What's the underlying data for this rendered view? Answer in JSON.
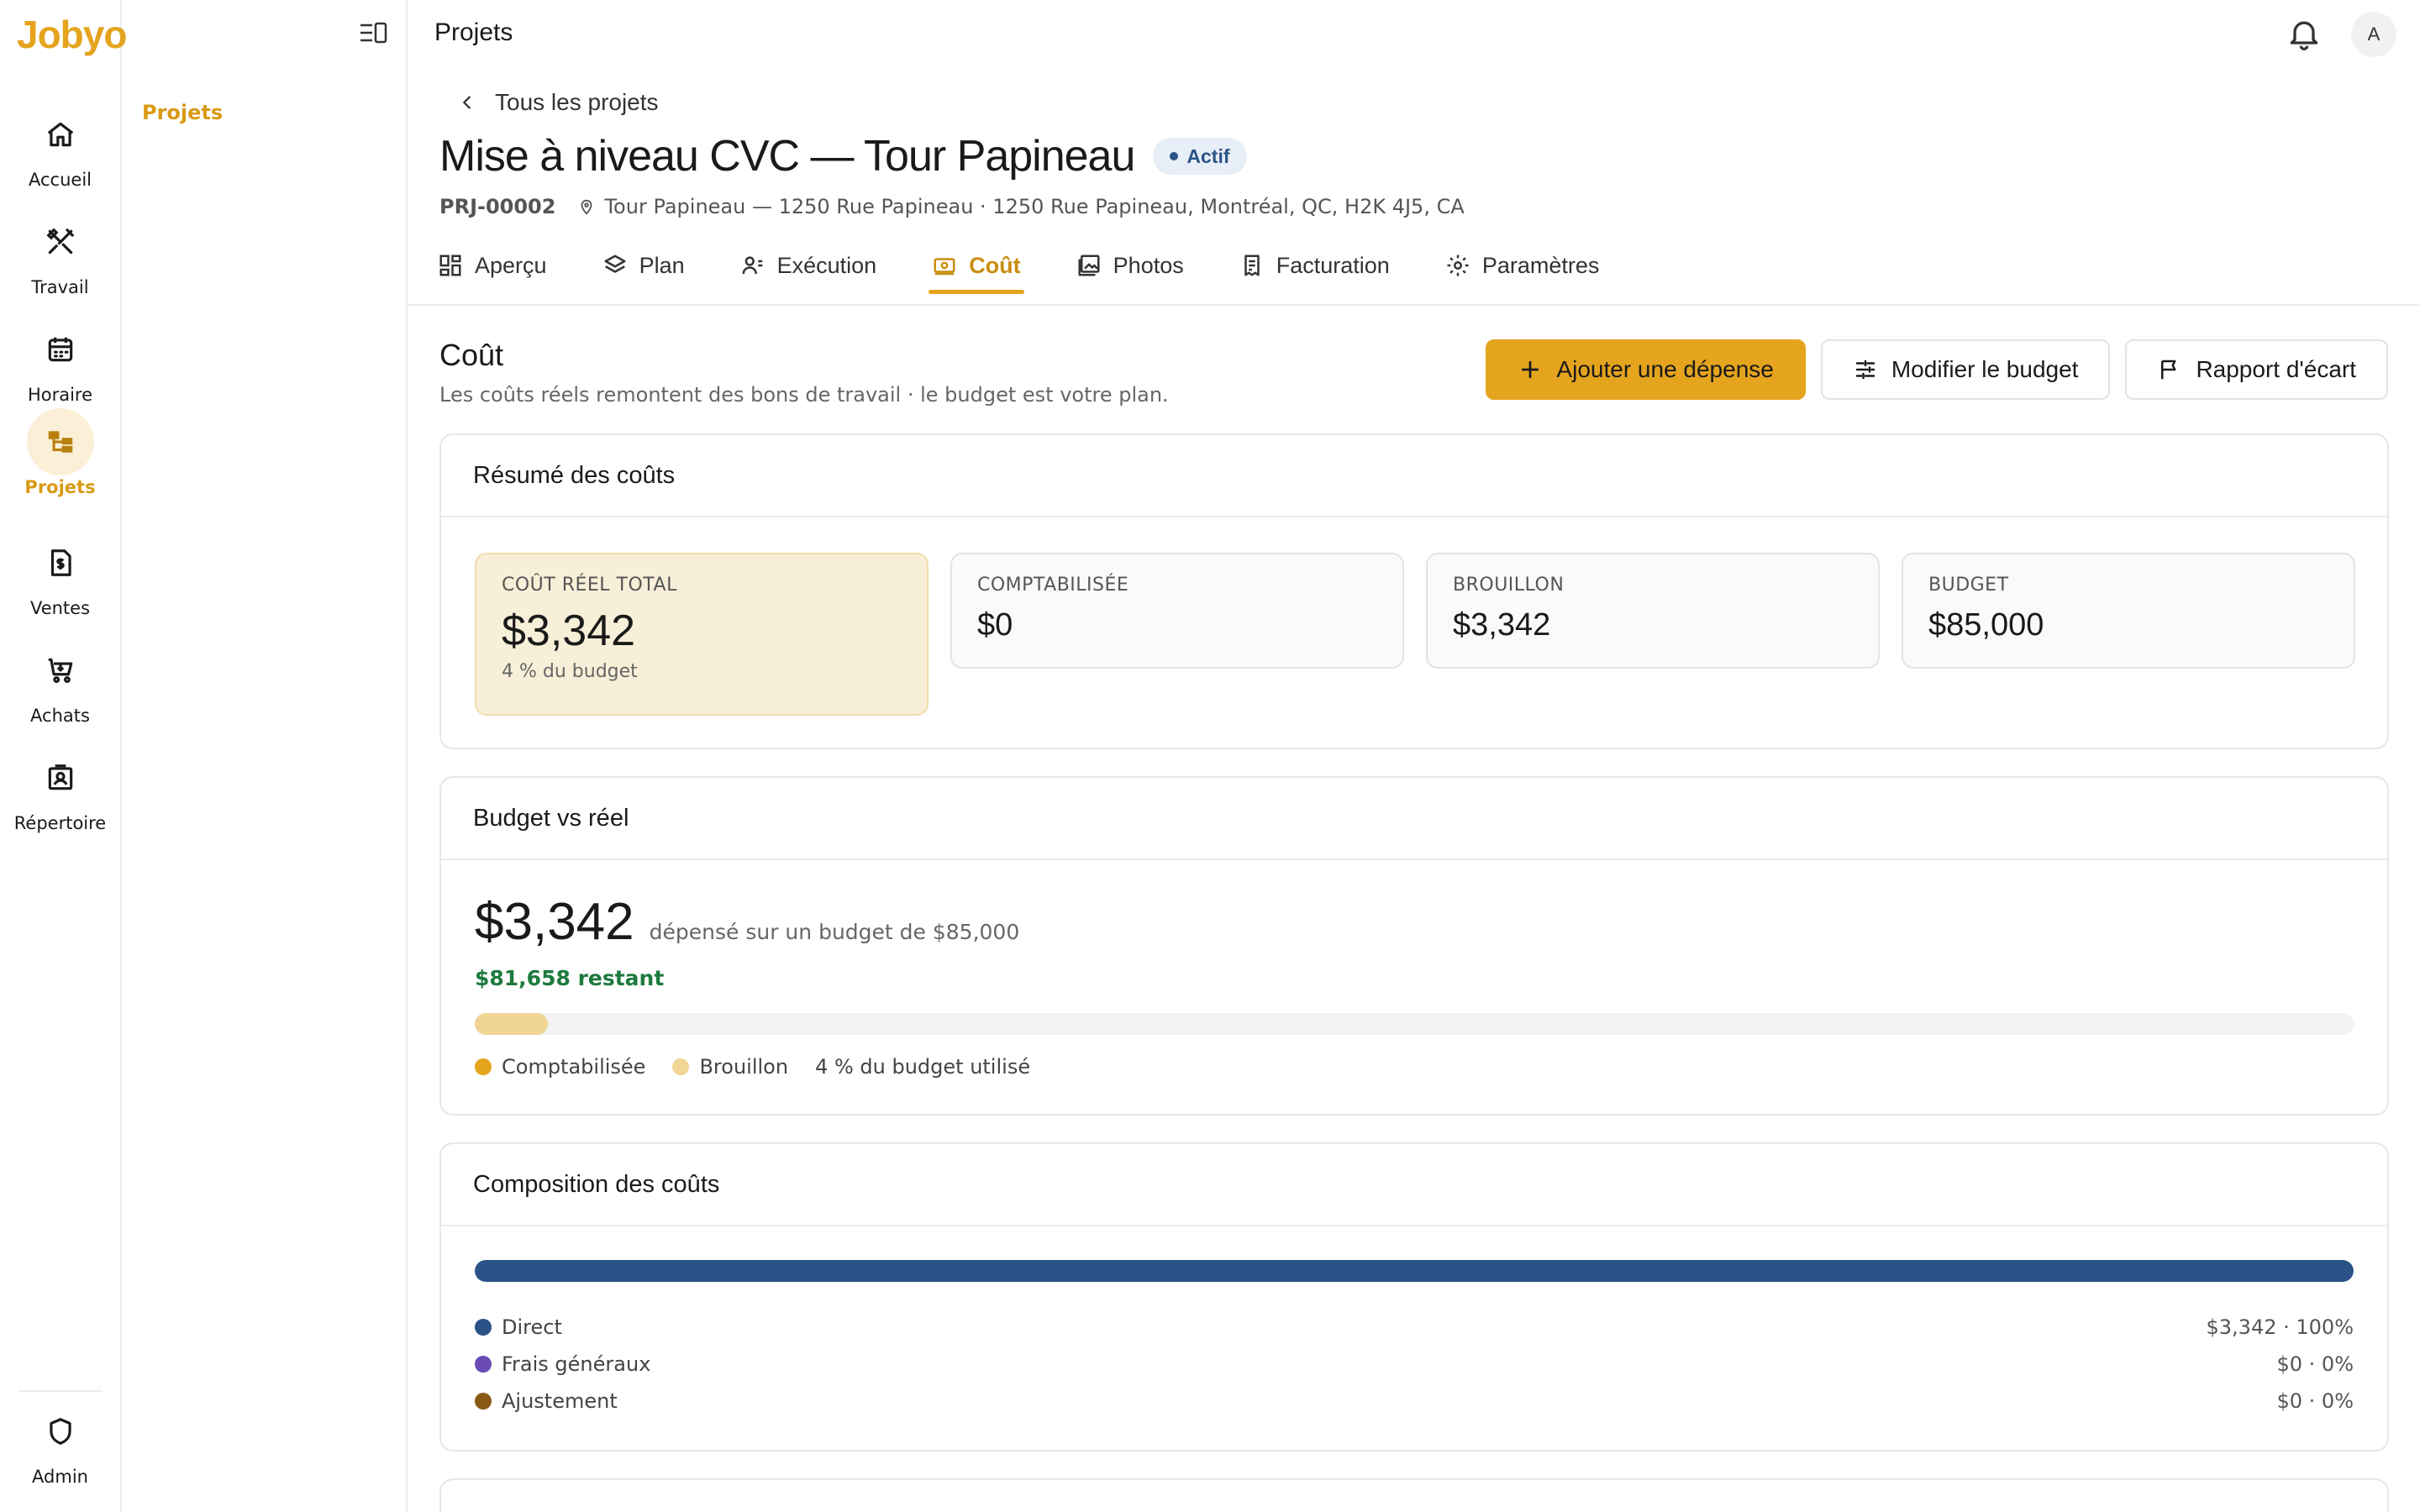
{
  "app": {
    "logo": "Jobyo",
    "page_title": "Projets",
    "avatar": "A"
  },
  "rail": {
    "items": [
      {
        "label": "Accueil",
        "icon": "home-icon"
      },
      {
        "label": "Travail",
        "icon": "tools-icon"
      },
      {
        "label": "Horaire",
        "icon": "calendar-icon"
      },
      {
        "label": "Projets",
        "icon": "projects-icon",
        "active": true
      },
      {
        "label": "Ventes",
        "icon": "invoice-icon"
      },
      {
        "label": "Achats",
        "icon": "cart-icon"
      },
      {
        "label": "Répertoire",
        "icon": "contacts-icon"
      }
    ],
    "bottom": {
      "label": "Admin",
      "icon": "shield-icon"
    }
  },
  "subbar": {
    "item": "Projets"
  },
  "project": {
    "back_label": "Tous les projets",
    "title": "Mise à niveau CVC — Tour Papineau",
    "status": "Actif",
    "code": "PRJ-00002",
    "address": "Tour Papineau — 1250 Rue Papineau · 1250 Rue Papineau, Montréal, QC, H2K 4J5, CA"
  },
  "tabs": [
    {
      "label": "Aperçu",
      "icon": "grid-icon"
    },
    {
      "label": "Plan",
      "icon": "layers-icon"
    },
    {
      "label": "Exécution",
      "icon": "worker-icon"
    },
    {
      "label": "Coût",
      "icon": "money-icon",
      "active": true
    },
    {
      "label": "Photos",
      "icon": "photos-icon"
    },
    {
      "label": "Facturation",
      "icon": "receipt-icon"
    },
    {
      "label": "Paramètres",
      "icon": "gear-icon"
    }
  ],
  "cost": {
    "title": "Coût",
    "subtitle": "Les coûts réels remontent des bons de travail · le budget est votre plan.",
    "buttons": {
      "add_expense": "Ajouter une dépense",
      "edit_budget": "Modifier le budget",
      "variance_report": "Rapport d'écart"
    }
  },
  "summary": {
    "title": "Résumé des coûts",
    "kpis": [
      {
        "label": "COÛT RÉEL TOTAL",
        "value": "$3,342",
        "sub": "4 % du budget"
      },
      {
        "label": "COMPTABILISÉE",
        "value": "$0"
      },
      {
        "label": "BROUILLON",
        "value": "$3,342"
      },
      {
        "label": "BUDGET",
        "value": "$85,000"
      }
    ]
  },
  "budget_vs_actual": {
    "title": "Budget vs réel",
    "amount": "$3,342",
    "text": "dépensé sur un budget de $85,000",
    "remaining": "$81,658 restant",
    "used_fraction": 0.039,
    "legend_posted": "Comptabilisée",
    "legend_draft": "Brouillon",
    "legend_used": "4 % du budget utilisé",
    "colors": {
      "posted": "#e5a41e",
      "draft": "#f1d594"
    }
  },
  "composition": {
    "title": "Composition des coûts",
    "rows": [
      {
        "label": "Direct",
        "value": "$3,342 · 100%",
        "color": "#2a5286",
        "fraction": 1.0
      },
      {
        "label": "Frais généraux",
        "value": "$0 · 0%",
        "color": "#6a4bb5",
        "fraction": 0
      },
      {
        "label": "Ajustement",
        "value": "$0 · 0%",
        "color": "#8a5a14",
        "fraction": 0
      }
    ]
  },
  "colors": {
    "accent": "#e5a41e",
    "status_blue": "#2a5286",
    "positive": "#1e7a3e"
  }
}
